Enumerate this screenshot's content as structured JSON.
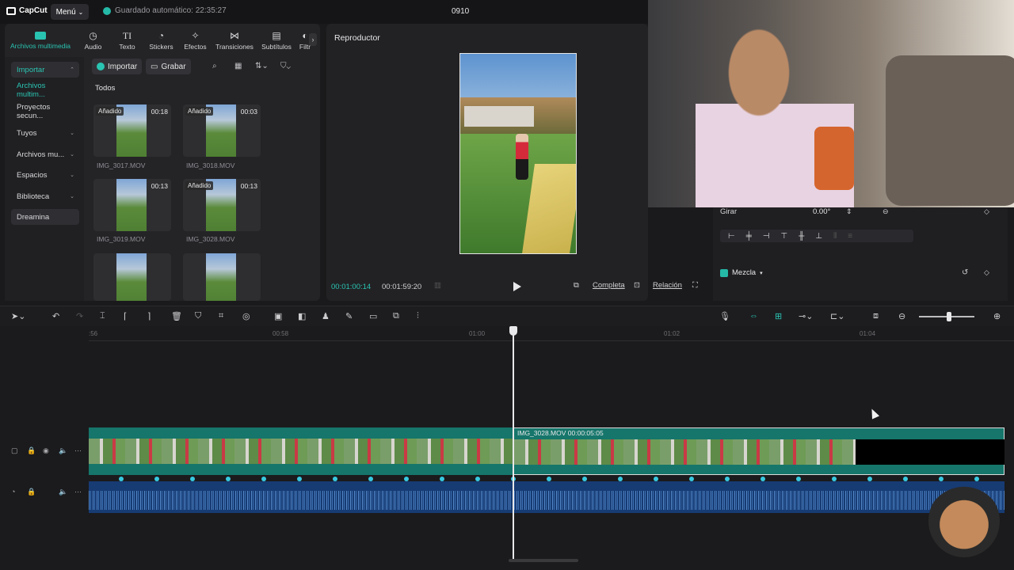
{
  "app": {
    "logo_text": "CapCut",
    "menu_label": "Menú",
    "autosave": "Guardado automático: 22:35:27",
    "project_name": "0910"
  },
  "tool_tabs": [
    {
      "label": "Archivos multimedia",
      "icon": "media-icon"
    },
    {
      "label": "Audio",
      "icon": "audio-icon"
    },
    {
      "label": "Texto",
      "icon": "text-icon"
    },
    {
      "label": "Stickers",
      "icon": "stickers-icon"
    },
    {
      "label": "Efectos",
      "icon": "effects-icon"
    },
    {
      "label": "Transiciones",
      "icon": "transitions-icon"
    },
    {
      "label": "Subtítulos",
      "icon": "subtitles-icon"
    },
    {
      "label": "Filtr",
      "icon": "filters-icon"
    }
  ],
  "side_nav": [
    {
      "label": "Importar",
      "chevron": "⌃"
    },
    {
      "label": "Archivos multim...",
      "chevron": ""
    },
    {
      "label": "Proyectos secun...",
      "chevron": ""
    },
    {
      "label": "Tuyos",
      "chevron": "⌄"
    },
    {
      "label": "Archivos mu...",
      "chevron": "⌄"
    },
    {
      "label": "Espacios",
      "chevron": "⌄"
    },
    {
      "label": "Biblioteca",
      "chevron": "⌄"
    },
    {
      "label": "Dreamina",
      "chevron": ""
    }
  ],
  "media_tools": {
    "import_label": "Importar",
    "record_label": "Grabar",
    "filter_label": "Todos"
  },
  "media_items": [
    {
      "name": "IMG_3017.MOV",
      "duration": "00:18",
      "badge": "Añadido"
    },
    {
      "name": "IMG_3018.MOV",
      "duration": "00:03",
      "badge": "Añadido"
    },
    {
      "name": "IMG_3019.MOV",
      "duration": "00:13",
      "badge": ""
    },
    {
      "name": "IMG_3028.MOV",
      "duration": "00:13",
      "badge": "Añadido"
    },
    {
      "name": "",
      "duration": "",
      "badge": ""
    },
    {
      "name": "",
      "duration": "",
      "badge": ""
    }
  ],
  "player": {
    "title": "Reproductor",
    "time_current": "00:01:00:14",
    "time_total": "00:01:59:20",
    "full_label": "Completa",
    "ratio_label": "Relación"
  },
  "properties": {
    "rotate_label": "Girar",
    "rotate_value": "0.00°",
    "blend_label": "Mezcla"
  },
  "timeline": {
    "ticks": [
      ":56",
      "00:58",
      "01:00",
      "01:02",
      "01:04"
    ],
    "clip_label": "IMG_3028.MOV  00:00:05:05"
  }
}
